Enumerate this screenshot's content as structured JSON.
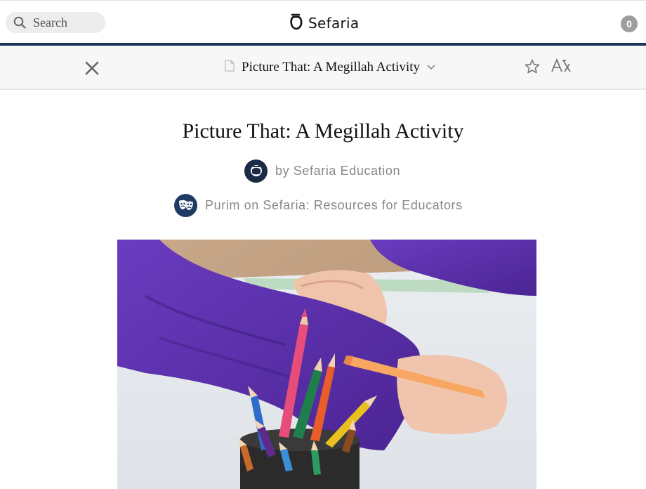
{
  "header": {
    "search": {
      "placeholder": "Search"
    },
    "logo": {
      "text": "Sefaria"
    },
    "notifications": {
      "count": "0"
    }
  },
  "reader_bar": {
    "title": "Picture That: A Megillah Activity"
  },
  "sheet": {
    "title": "Picture That: A Megillah Activity",
    "author": "by Sefaria Education",
    "collection": "Purim on Sefaria: Resources for Educators"
  },
  "colors": {
    "nav_rule": "#18345d",
    "muted_text": "#888888",
    "purple_sleeve": "#5b2fa6"
  },
  "icons": [
    "search-icon",
    "sefaria-logo-icon",
    "close-icon",
    "sheet-doc-icon",
    "chevron-down-icon",
    "star-icon",
    "font-size-icon",
    "author-avatar",
    "collection-mask-icon"
  ]
}
